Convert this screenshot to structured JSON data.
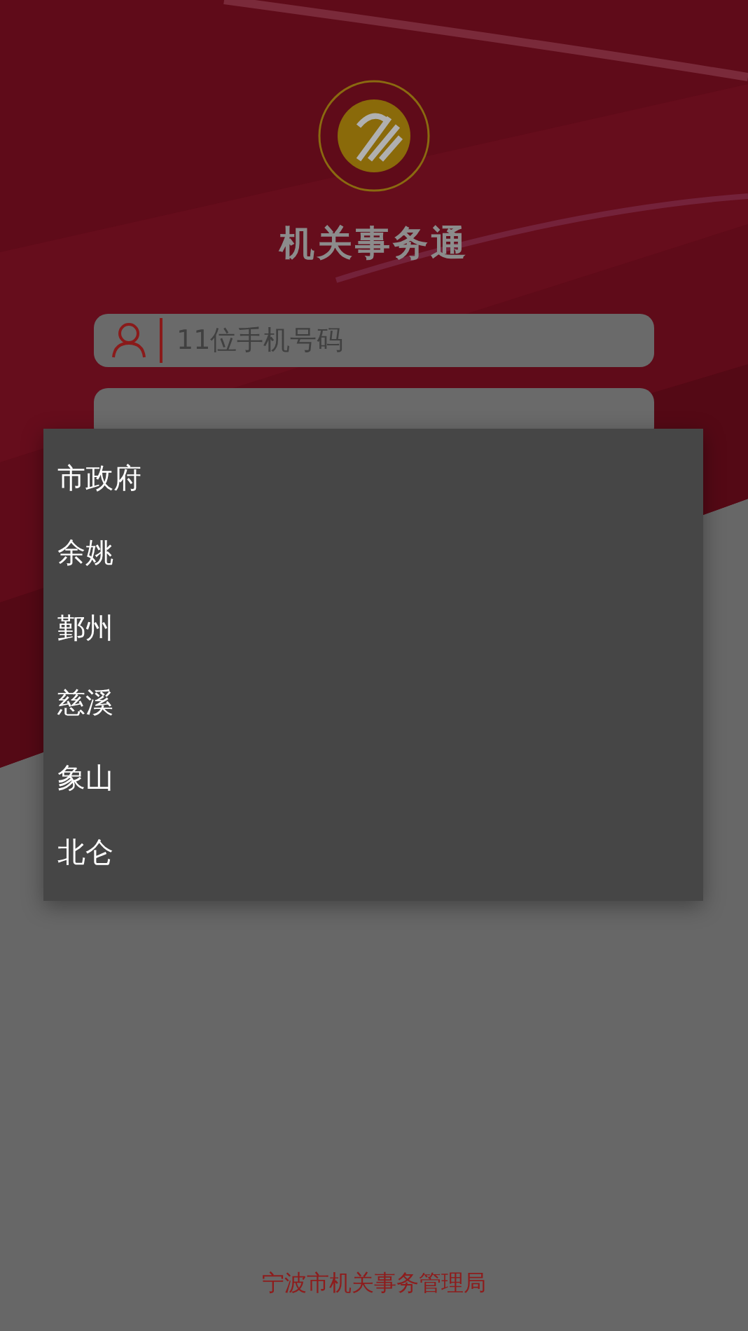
{
  "app_title": "机关事务通",
  "phone_field": {
    "placeholder": "11位手机号码"
  },
  "dropdown": {
    "items": [
      {
        "label": "市政府"
      },
      {
        "label": "余姚"
      },
      {
        "label": "鄞州"
      },
      {
        "label": "慈溪"
      },
      {
        "label": "象山"
      },
      {
        "label": "北仑"
      }
    ]
  },
  "footer": "宁波市机关事务管理局"
}
